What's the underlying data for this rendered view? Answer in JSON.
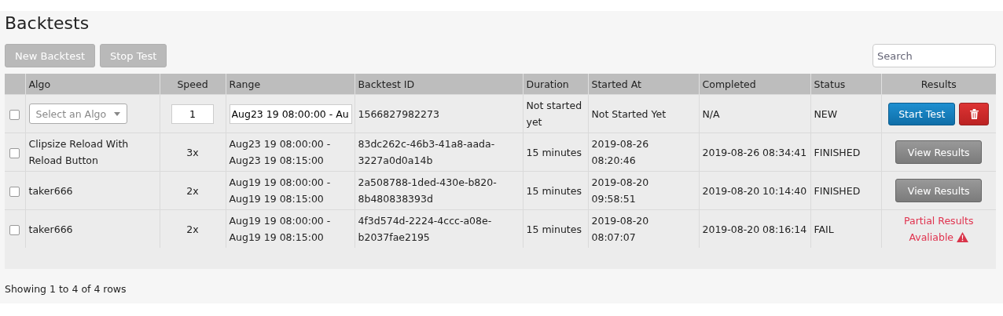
{
  "title": "Backtests",
  "toolbar": {
    "buttons": [
      {
        "label": "New Backtest",
        "disabled": true
      },
      {
        "label": "Stop Test",
        "disabled": true
      }
    ],
    "search": {
      "placeholder": "Search"
    }
  },
  "table": {
    "columns": [
      {
        "label": "Algo"
      },
      {
        "label": "Speed"
      },
      {
        "label": "Range"
      },
      {
        "label": "Backtest ID"
      },
      {
        "label": "Duration"
      },
      {
        "label": "Started At"
      },
      {
        "label": "Completed"
      },
      {
        "label": "Status"
      },
      {
        "label": "Results"
      }
    ],
    "rows": [
      {
        "kind": "new",
        "checked": false,
        "algo_placeholder": "Select an Algo",
        "speed": "1",
        "range": "Aug23 19 08:00:00 - Au",
        "id": "1566827982273",
        "duration": "Not started yet",
        "started": "Not Started Yet",
        "completed": "N/A",
        "status": "NEW",
        "result": {
          "kind": "start",
          "label": "Start Test"
        }
      },
      {
        "kind": "run",
        "checked": false,
        "algo": "Clipsize Reload With Reload Button",
        "speed": "3x",
        "range": "Aug23 19 08:00:00 - Aug23 19 08:15:00",
        "id": "83dc262c-46b3-41a8-aada-3227a0d0a14b",
        "duration": "15 minutes",
        "started": "2019-08-26 08:20:46",
        "completed": "2019-08-26 08:34:41",
        "status": "FINISHED",
        "result": {
          "kind": "view",
          "label": "View Results"
        }
      },
      {
        "kind": "run",
        "checked": false,
        "algo": "taker666",
        "speed": "2x",
        "range": "Aug19 19 08:00:00 - Aug19 19 08:15:00",
        "id": "2a508788-1ded-430e-b820-8b480838393d",
        "duration": "15 minutes",
        "started": "2019-08-20 09:58:51",
        "completed": "2019-08-20 10:14:40",
        "status": "FINISHED",
        "result": {
          "kind": "view",
          "label": "View Results"
        }
      },
      {
        "kind": "run",
        "checked": false,
        "algo": "taker666",
        "speed": "2x",
        "range": "Aug19 19 08:00:00 - Aug19 19 08:15:00",
        "id": "4f3d574d-2224-4ccc-a08e-b2037fae2195",
        "duration": "15 minutes",
        "started": "2019-08-20 08:07:07",
        "completed": "2019-08-20 08:16:14",
        "status": "FAIL",
        "result": {
          "kind": "partial",
          "label": "Partial Results Avaliable"
        }
      }
    ]
  },
  "footer": "Showing 1 to 4 of 4 rows"
}
